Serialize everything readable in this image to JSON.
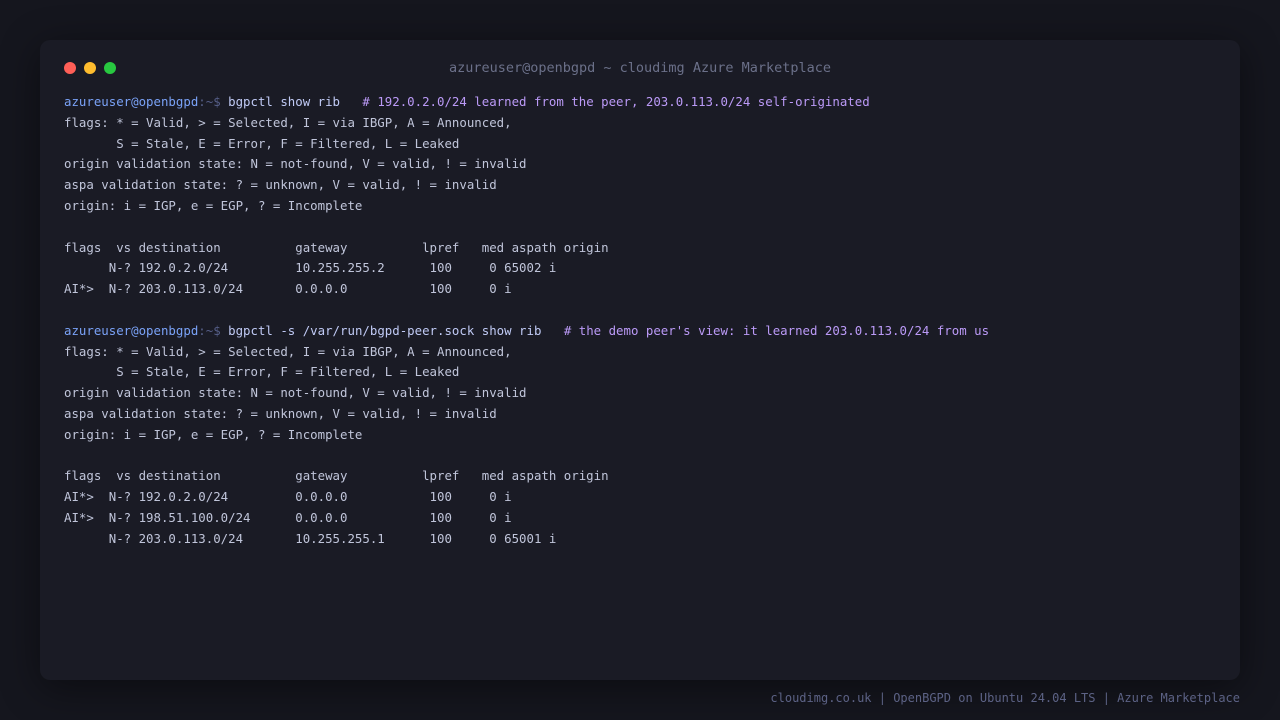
{
  "window": {
    "title": "azureuser@openbgpd ~ cloudimg Azure Marketplace"
  },
  "colors": {
    "background": "#15161e",
    "window_bg": "#1a1b25",
    "prompt": "#7aa2f7",
    "comment": "#bb9af7",
    "text": "#c0c5da",
    "traffic_red": "#ff5f57",
    "traffic_yellow": "#febc2e",
    "traffic_green": "#28c840"
  },
  "terminal": {
    "block1": {
      "prompt_user": "azureuser@openbgpd",
      "prompt_sep": ":~$ ",
      "command": "bgpctl show rib   ",
      "comment": "# 192.0.2.0/24 learned from the peer, 203.0.113.0/24 self-originated",
      "legend": [
        "flags: * = Valid, > = Selected, I = via IBGP, A = Announced,",
        "       S = Stale, E = Error, F = Filtered, L = Leaked",
        "origin validation state: N = not-found, V = valid, ! = invalid",
        "aspa validation state: ? = unknown, V = valid, ! = invalid",
        "origin: i = IGP, e = EGP, ? = Incomplete"
      ],
      "header": "flags  vs destination          gateway          lpref   med aspath origin",
      "rows": [
        "      N-? 192.0.2.0/24         10.255.255.2      100     0 65002 i",
        "AI*>  N-? 203.0.113.0/24       0.0.0.0           100     0 i"
      ]
    },
    "block2": {
      "prompt_user": "azureuser@openbgpd",
      "prompt_sep": ":~$ ",
      "command": "bgpctl -s /var/run/bgpd-peer.sock show rib   ",
      "comment": "# the demo peer's view: it learned 203.0.113.0/24 from us",
      "legend": [
        "flags: * = Valid, > = Selected, I = via IBGP, A = Announced,",
        "       S = Stale, E = Error, F = Filtered, L = Leaked",
        "origin validation state: N = not-found, V = valid, ! = invalid",
        "aspa validation state: ? = unknown, V = valid, ! = invalid",
        "origin: i = IGP, e = EGP, ? = Incomplete"
      ],
      "header": "flags  vs destination          gateway          lpref   med aspath origin",
      "rows": [
        "AI*>  N-? 192.0.2.0/24         0.0.0.0           100     0 i",
        "AI*>  N-? 198.51.100.0/24      0.0.0.0           100     0 i",
        "      N-? 203.0.113.0/24       10.255.255.1      100     0 65001 i"
      ]
    }
  },
  "footer": {
    "text": "cloudimg.co.uk | OpenBGPD on Ubuntu 24.04 LTS | Azure Marketplace"
  }
}
